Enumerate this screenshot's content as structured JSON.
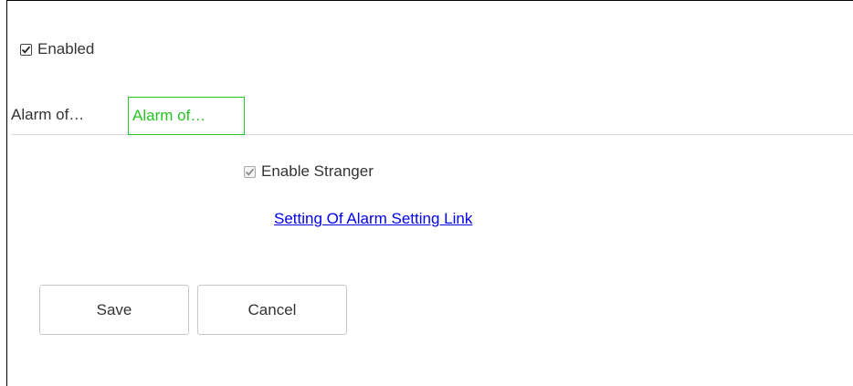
{
  "enabled": {
    "label": "Enabled",
    "checked": true
  },
  "tabs": [
    {
      "label": "Alarm of…",
      "active": false
    },
    {
      "label": "Alarm of…",
      "active": true
    }
  ],
  "stranger": {
    "label": "Enable Stranger",
    "checked": true,
    "disabled": true
  },
  "link": {
    "label": "Setting Of Alarm Setting Link"
  },
  "buttons": {
    "save_label": "Save",
    "cancel_label": "Cancel"
  },
  "colors": {
    "active_tab": "#22c522",
    "link": "#0000ee",
    "text": "#333333"
  },
  "icons": {
    "checkbox_checked": "checkmark-icon"
  }
}
